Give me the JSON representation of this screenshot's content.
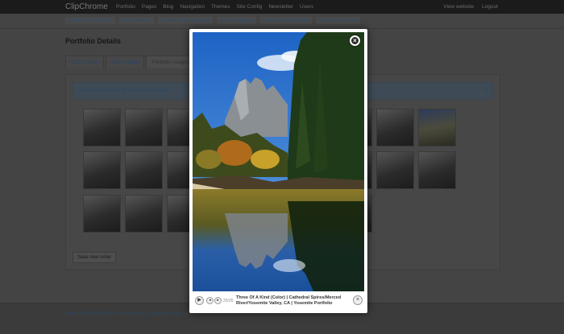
{
  "topbar": {
    "brand": "ClipChrome",
    "nav": [
      "Portfolio",
      "Pages",
      "Blog",
      "Navigation",
      "Themes",
      "Site Config",
      "Newsletter",
      "Users"
    ],
    "right": [
      "View website",
      "Logout"
    ]
  },
  "subnav": [
    "Create new Gallery",
    "List Galleries",
    "Create new Category",
    "List Categories",
    "Home Gallery/Slider",
    "Portfolio Settings"
  ],
  "page": {
    "title": "Portfolio Details",
    "tabs": [
      "Edit Gallery",
      "Add Images",
      "Portfolio Images"
    ],
    "alert": "25 registered items. Drag items to reorder.",
    "alert_close": "×",
    "save_label": "Save new order"
  },
  "footer": {
    "text": "Powered by ClipChrome. Developed by Jibnoran Franco"
  },
  "lightbox": {
    "counter": "25/25",
    "caption": "Three Of A Kind (Color) | Cathedral Spires/Merced River/Yosemite Valley, CA | Yosemite Portfolio",
    "close_glyph": "×",
    "play_glyph": "▶",
    "prev_glyph": "◂",
    "next_glyph": "▸"
  },
  "colors": {
    "overlay": "#3a3a3a",
    "lightbox_bg": "#ffffff",
    "sky": "#2470c8"
  }
}
